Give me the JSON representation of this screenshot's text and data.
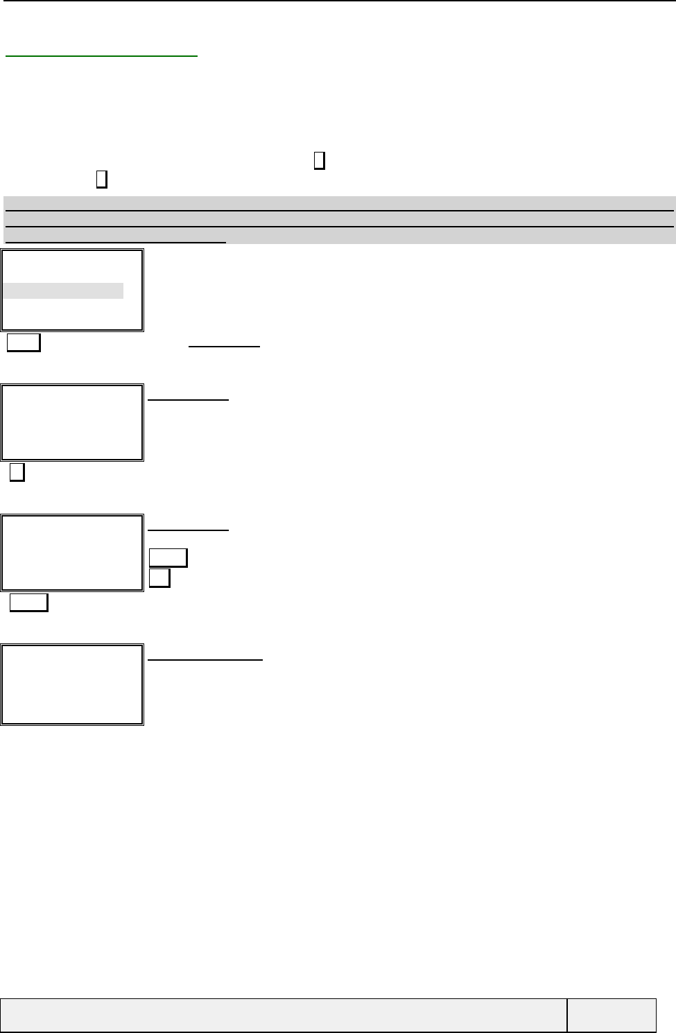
{
  "intro": {
    "lines": [
      {
        "kind": "link"
      },
      {
        "kind": "key"
      },
      {
        "kind": "key"
      }
    ]
  },
  "shaded_panel": {
    "lines": [
      {
        "kind": "full"
      },
      {
        "kind": "full"
      },
      {
        "kind": "short"
      }
    ]
  },
  "figures": [
    {
      "rows": [
        {
          "selected": false
        },
        {
          "selected": false
        },
        {
          "selected": true
        }
      ],
      "below": [
        {
          "kind": "key"
        },
        {
          "kind": "rule"
        }
      ]
    },
    {
      "beside": [
        {
          "kind": "rule"
        }
      ],
      "below": [
        {
          "kind": "key"
        }
      ]
    },
    {
      "beside": [
        {
          "kind": "rule"
        },
        {
          "kind": "key"
        },
        {
          "kind": "key"
        }
      ],
      "below": [
        {
          "kind": "key"
        }
      ]
    },
    {
      "beside": [
        {
          "kind": "rule"
        }
      ]
    }
  ],
  "footer": {
    "cells": [
      {
        "kind": "main"
      },
      {
        "kind": "side"
      }
    ]
  }
}
